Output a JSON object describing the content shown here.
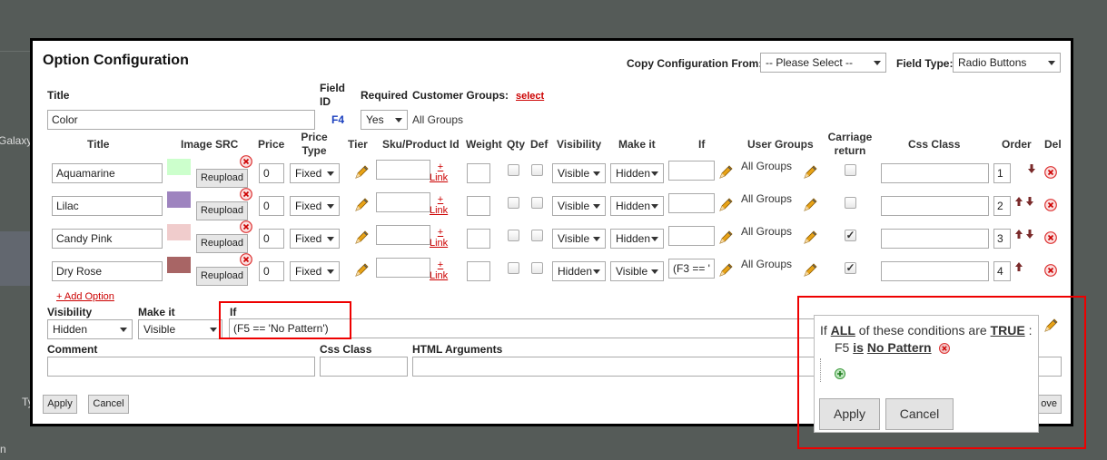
{
  "background": {
    "left_text": "Galaxy",
    "left_text2": "Ty",
    "left_text3": "n"
  },
  "dialog": {
    "title": "Option Configuration",
    "copy_label": "Copy Configuration From:",
    "copy_value": "-- Please Select --",
    "field_type_label": "Field Type:",
    "field_type_value": "Radio Buttons",
    "labels": {
      "title": "Title",
      "field_id": "Field ID",
      "required": "Required",
      "customer_groups": "Customer Groups:",
      "select_link": "select"
    },
    "title_value": "Color",
    "field_id_value": "F4",
    "required_value": "Yes",
    "groups_value": "All Groups",
    "columns": [
      "Title",
      "Image SRC",
      "Price",
      "Price Type",
      "Tier",
      "Sku/Product Id",
      "Weight",
      "Qty",
      "Def",
      "Visibility",
      "Make it",
      "If",
      "User Groups",
      "Carriage return",
      "Css Class",
      "Order",
      "Del"
    ],
    "reupload_label": "Reupload",
    "plus_label": "+",
    "link_label": "Link",
    "rows": [
      {
        "title": "Aquamarine",
        "color": "#ccffcc",
        "price": "0",
        "price_type": "Fixed",
        "visibility": "Visible",
        "make_it": "Hidden",
        "if": "",
        "groups": "All Groups",
        "carriage": false,
        "order": "1"
      },
      {
        "title": "Lilac",
        "color": "#9e84bf",
        "price": "0",
        "price_type": "Fixed",
        "visibility": "Visible",
        "make_it": "Hidden",
        "if": "",
        "groups": "All Groups",
        "carriage": false,
        "order": "2"
      },
      {
        "title": "Candy Pink",
        "color": "#f0cccc",
        "price": "0",
        "price_type": "Fixed",
        "visibility": "Visible",
        "make_it": "Hidden",
        "if": "",
        "groups": "All Groups",
        "carriage": true,
        "order": "3"
      },
      {
        "title": "Dry Rose",
        "color": "#a86565",
        "price": "0",
        "price_type": "Fixed",
        "visibility": "Hidden",
        "make_it": "Visible",
        "if": "(F3 == 'I",
        "groups": "All Groups",
        "carriage": true,
        "order": "4"
      }
    ],
    "add_option": "+ Add Option",
    "bottom": {
      "visibility_label": "Visibility",
      "visibility_value": "Hidden",
      "make_it_label": "Make it",
      "make_it_value": "Visible",
      "if_label": "If",
      "if_value": "(F5 == 'No Pattern')",
      "comment_label": "Comment",
      "css_class_label": "Css Class",
      "html_args_label": "HTML Arguments"
    },
    "apply": "Apply",
    "cancel": "Cancel",
    "remove_partial": "ove"
  },
  "popup": {
    "if_word": "If",
    "all_word": "ALL",
    "middle": "of these conditions are",
    "true_word": "TRUE",
    "colon": ":",
    "cond_field": "F5",
    "cond_op": "is",
    "cond_value": "No Pattern",
    "apply": "Apply",
    "cancel": "Cancel"
  },
  "colors": {
    "accent_red": "#dd0000",
    "link_red": "#cc0000",
    "field_id_blue": "#1a3fbf",
    "highlight_box": "#ee0000"
  }
}
